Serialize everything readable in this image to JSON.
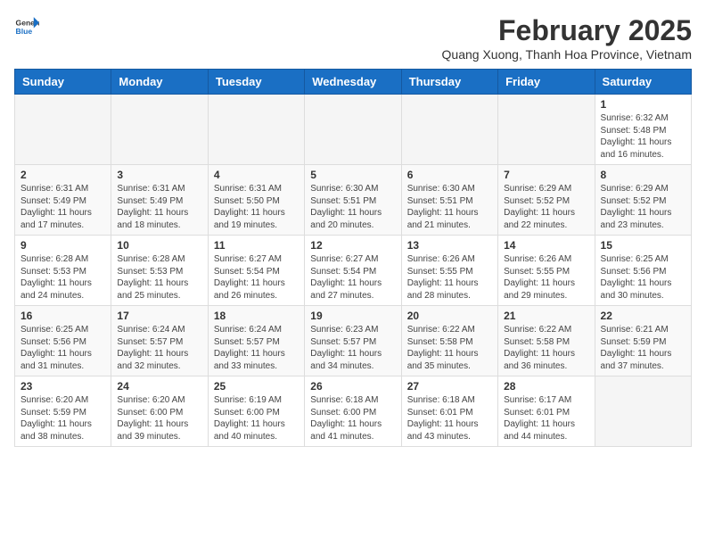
{
  "header": {
    "logo_general": "General",
    "logo_blue": "Blue",
    "title": "February 2025",
    "subtitle": "Quang Xuong, Thanh Hoa Province, Vietnam"
  },
  "weekdays": [
    "Sunday",
    "Monday",
    "Tuesday",
    "Wednesday",
    "Thursday",
    "Friday",
    "Saturday"
  ],
  "weeks": [
    [
      {
        "day": "",
        "info": ""
      },
      {
        "day": "",
        "info": ""
      },
      {
        "day": "",
        "info": ""
      },
      {
        "day": "",
        "info": ""
      },
      {
        "day": "",
        "info": ""
      },
      {
        "day": "",
        "info": ""
      },
      {
        "day": "1",
        "info": "Sunrise: 6:32 AM\nSunset: 5:48 PM\nDaylight: 11 hours and 16 minutes."
      }
    ],
    [
      {
        "day": "2",
        "info": "Sunrise: 6:31 AM\nSunset: 5:49 PM\nDaylight: 11 hours and 17 minutes."
      },
      {
        "day": "3",
        "info": "Sunrise: 6:31 AM\nSunset: 5:49 PM\nDaylight: 11 hours and 18 minutes."
      },
      {
        "day": "4",
        "info": "Sunrise: 6:31 AM\nSunset: 5:50 PM\nDaylight: 11 hours and 19 minutes."
      },
      {
        "day": "5",
        "info": "Sunrise: 6:30 AM\nSunset: 5:51 PM\nDaylight: 11 hours and 20 minutes."
      },
      {
        "day": "6",
        "info": "Sunrise: 6:30 AM\nSunset: 5:51 PM\nDaylight: 11 hours and 21 minutes."
      },
      {
        "day": "7",
        "info": "Sunrise: 6:29 AM\nSunset: 5:52 PM\nDaylight: 11 hours and 22 minutes."
      },
      {
        "day": "8",
        "info": "Sunrise: 6:29 AM\nSunset: 5:52 PM\nDaylight: 11 hours and 23 minutes."
      }
    ],
    [
      {
        "day": "9",
        "info": "Sunrise: 6:28 AM\nSunset: 5:53 PM\nDaylight: 11 hours and 24 minutes."
      },
      {
        "day": "10",
        "info": "Sunrise: 6:28 AM\nSunset: 5:53 PM\nDaylight: 11 hours and 25 minutes."
      },
      {
        "day": "11",
        "info": "Sunrise: 6:27 AM\nSunset: 5:54 PM\nDaylight: 11 hours and 26 minutes."
      },
      {
        "day": "12",
        "info": "Sunrise: 6:27 AM\nSunset: 5:54 PM\nDaylight: 11 hours and 27 minutes."
      },
      {
        "day": "13",
        "info": "Sunrise: 6:26 AM\nSunset: 5:55 PM\nDaylight: 11 hours and 28 minutes."
      },
      {
        "day": "14",
        "info": "Sunrise: 6:26 AM\nSunset: 5:55 PM\nDaylight: 11 hours and 29 minutes."
      },
      {
        "day": "15",
        "info": "Sunrise: 6:25 AM\nSunset: 5:56 PM\nDaylight: 11 hours and 30 minutes."
      }
    ],
    [
      {
        "day": "16",
        "info": "Sunrise: 6:25 AM\nSunset: 5:56 PM\nDaylight: 11 hours and 31 minutes."
      },
      {
        "day": "17",
        "info": "Sunrise: 6:24 AM\nSunset: 5:57 PM\nDaylight: 11 hours and 32 minutes."
      },
      {
        "day": "18",
        "info": "Sunrise: 6:24 AM\nSunset: 5:57 PM\nDaylight: 11 hours and 33 minutes."
      },
      {
        "day": "19",
        "info": "Sunrise: 6:23 AM\nSunset: 5:57 PM\nDaylight: 11 hours and 34 minutes."
      },
      {
        "day": "20",
        "info": "Sunrise: 6:22 AM\nSunset: 5:58 PM\nDaylight: 11 hours and 35 minutes."
      },
      {
        "day": "21",
        "info": "Sunrise: 6:22 AM\nSunset: 5:58 PM\nDaylight: 11 hours and 36 minutes."
      },
      {
        "day": "22",
        "info": "Sunrise: 6:21 AM\nSunset: 5:59 PM\nDaylight: 11 hours and 37 minutes."
      }
    ],
    [
      {
        "day": "23",
        "info": "Sunrise: 6:20 AM\nSunset: 5:59 PM\nDaylight: 11 hours and 38 minutes."
      },
      {
        "day": "24",
        "info": "Sunrise: 6:20 AM\nSunset: 6:00 PM\nDaylight: 11 hours and 39 minutes."
      },
      {
        "day": "25",
        "info": "Sunrise: 6:19 AM\nSunset: 6:00 PM\nDaylight: 11 hours and 40 minutes."
      },
      {
        "day": "26",
        "info": "Sunrise: 6:18 AM\nSunset: 6:00 PM\nDaylight: 11 hours and 41 minutes."
      },
      {
        "day": "27",
        "info": "Sunrise: 6:18 AM\nSunset: 6:01 PM\nDaylight: 11 hours and 43 minutes."
      },
      {
        "day": "28",
        "info": "Sunrise: 6:17 AM\nSunset: 6:01 PM\nDaylight: 11 hours and 44 minutes."
      },
      {
        "day": "",
        "info": ""
      }
    ]
  ]
}
